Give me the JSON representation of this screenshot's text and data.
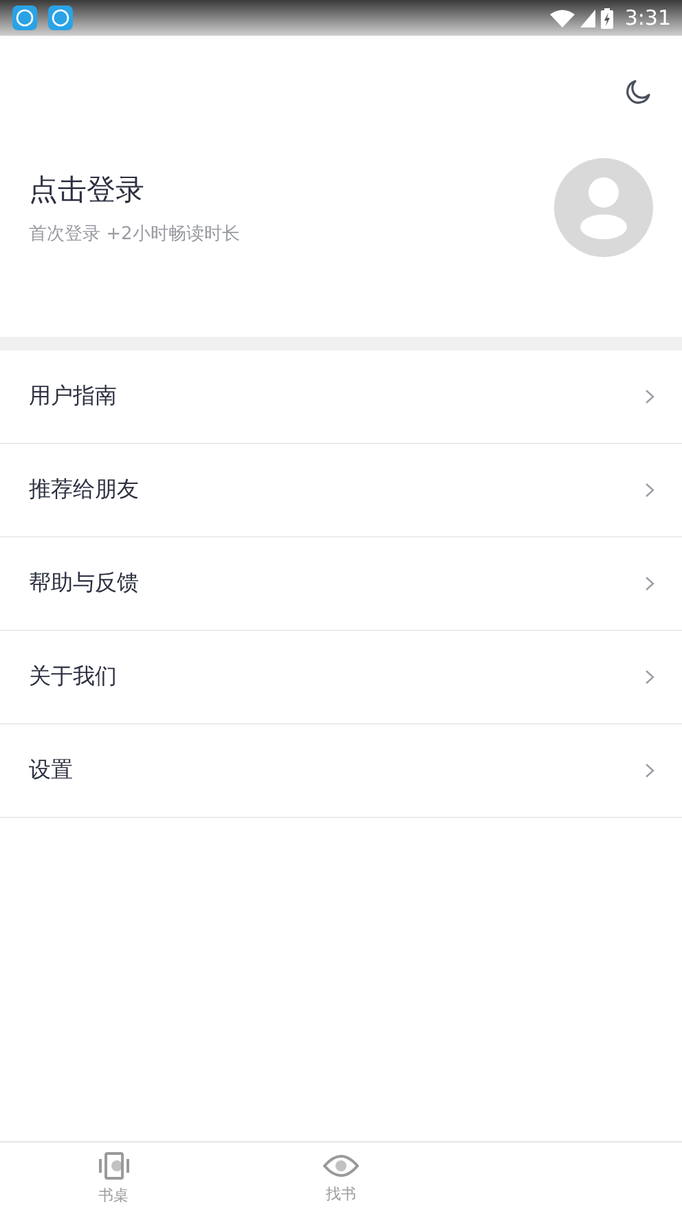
{
  "status_bar": {
    "time": "3:31"
  },
  "profile": {
    "title": "点击登录",
    "subtitle": "首次登录 +2小时畅读时长"
  },
  "menu": [
    {
      "label": "用户指南"
    },
    {
      "label": "推荐给朋友"
    },
    {
      "label": "帮助与反馈"
    },
    {
      "label": "关于我们"
    },
    {
      "label": "设置"
    }
  ],
  "bottom_nav": [
    {
      "label": "书桌",
      "kind": "desk",
      "selected": false
    },
    {
      "label": "找书",
      "kind": "eye",
      "selected": false
    }
  ]
}
